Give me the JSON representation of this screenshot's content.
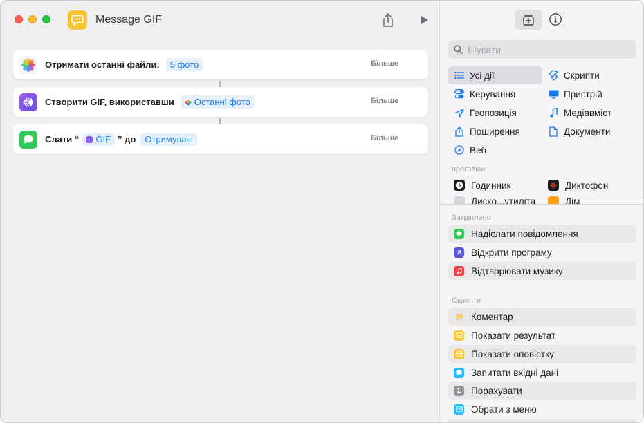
{
  "window": {
    "title": "Message GIF"
  },
  "actions": [
    {
      "text": "Отримати останні файли:",
      "token": "5 фото",
      "more": "Більше"
    },
    {
      "text": "Створити GIF, використавши",
      "token": "Останні фото",
      "more": "Більше"
    },
    {
      "text_before": "Слати “",
      "token1": "GIF",
      "text_mid": "” до",
      "token2": "Отримувачі",
      "more": "Більше"
    }
  ],
  "sidebar": {
    "search_placeholder": "Шукати",
    "categories": [
      {
        "label": "Усі дії",
        "icon": "list-icon"
      },
      {
        "label": "Скрипти",
        "icon": "scripts-icon"
      },
      {
        "label": "Керування",
        "icon": "toggle-icon"
      },
      {
        "label": "Пристрій",
        "icon": "monitor-icon"
      },
      {
        "label": "Геопозиція",
        "icon": "location-icon"
      },
      {
        "label": "Медіавміст",
        "icon": "music-note-icon"
      },
      {
        "label": "Поширення",
        "icon": "share-icon"
      },
      {
        "label": "Документи",
        "icon": "document-icon"
      },
      {
        "label": "Веб",
        "icon": "compass-icon"
      }
    ],
    "apps_label": "програми",
    "apps": [
      {
        "label": "Годинник",
        "icon": "clock-icon"
      },
      {
        "label": "Диктофон",
        "icon": "voice-memos-icon"
      },
      {
        "label": "Диско...утиліта",
        "icon": "disk-utility-icon"
      },
      {
        "label": "Дім",
        "icon": "home-icon"
      }
    ],
    "pinned_label": "Закріплено",
    "pinned": [
      {
        "label": "Надіслати повідомлення",
        "icon": "messages-icon",
        "color": "#34c759"
      },
      {
        "label": "Відкрити програму",
        "icon": "open-app-icon",
        "color": "#5856d6"
      },
      {
        "label": "Відтворювати музику",
        "icon": "music-icon",
        "color": "#fc3c44"
      }
    ],
    "scripts_label": "Скрипти",
    "scripts": [
      {
        "label": "Коментар",
        "icon": "comment-icon",
        "color": "#f7c531"
      },
      {
        "label": "Показати результат",
        "icon": "show-result-icon",
        "color": "#f7c531"
      },
      {
        "label": "Показати оповістку",
        "icon": "alert-icon",
        "color": "#f7c531"
      },
      {
        "label": "Запитати вхідні дані",
        "icon": "ask-input-icon",
        "color": "#29b6f6"
      },
      {
        "label": "Порахувати",
        "icon": "sigma-icon",
        "color": "#8e8e93"
      },
      {
        "label": "Обрати з меню",
        "icon": "menu-icon",
        "color": "#29b6f6"
      }
    ]
  }
}
